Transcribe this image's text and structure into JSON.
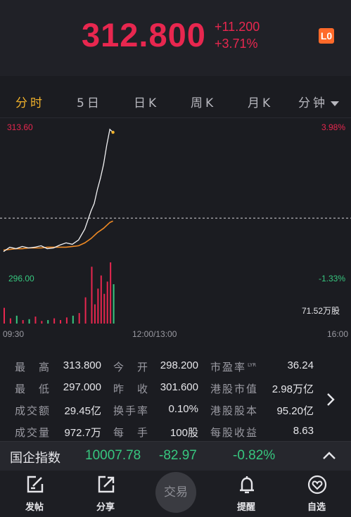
{
  "quote": {
    "price": "312.800",
    "change_abs": "+11.200",
    "change_pct": "+3.71%",
    "badge": "L0"
  },
  "tabs": [
    {
      "label": "分时",
      "active": true
    },
    {
      "label": "5日"
    },
    {
      "label": "日K"
    },
    {
      "label": "周K"
    },
    {
      "label": "月K"
    },
    {
      "label": "分钟"
    }
  ],
  "chart": {
    "price_high": "313.60",
    "pct_high": "3.98%",
    "price_low": "296.00",
    "pct_low": "-1.33%",
    "volume_label": "71.52万股",
    "time_start": "09:30",
    "time_mid": "12:00/13:00",
    "time_end": "16:00"
  },
  "chart_data": {
    "type": "line",
    "x": [
      0,
      2,
      4,
      6,
      8,
      10,
      12,
      14,
      16,
      18,
      20,
      22,
      24,
      26,
      28,
      29,
      30,
      31,
      32,
      33,
      34,
      35
    ],
    "price": [
      297.0,
      297.6,
      297.4,
      297.7,
      297.5,
      297.6,
      297.8,
      297.4,
      297.5,
      297.9,
      298.2,
      298.0,
      298.6,
      300.1,
      302.6,
      303.6,
      305.5,
      307.1,
      309.0,
      311.6,
      313.8,
      313.4
    ],
    "avg": [
      297.2,
      297.3,
      297.4,
      297.4,
      297.5,
      297.5,
      297.5,
      297.6,
      297.6,
      297.6,
      297.6,
      297.7,
      297.8,
      298.2,
      298.8,
      299.2,
      299.6,
      299.9,
      300.2,
      300.6,
      301.0,
      301.2
    ],
    "volume": [
      18,
      6,
      9,
      4,
      5,
      8,
      3,
      4,
      6,
      4,
      7,
      9,
      12,
      30,
      65,
      22,
      40,
      55,
      34,
      48,
      70,
      45
    ],
    "ylim": [
      296.0,
      313.6
    ],
    "prev_close": 301.6
  },
  "stats": {
    "high_label": "最　高",
    "high": "313.800",
    "open_label": "今　开",
    "open": "298.200",
    "pe_label": "市盈率",
    "pe_sup": "LYR",
    "pe": "36.24",
    "low_label": "最　低",
    "low": "297.000",
    "prev_label": "昨　收",
    "prev": "301.600",
    "mcap_label": "港股市值",
    "mcap": "2.98万亿",
    "turnover_label": "成交额",
    "turnover": "29.45亿",
    "rate_label": "换手率",
    "rate": "0.10%",
    "shares_label": "港股股本",
    "shares": "95.20亿",
    "vol_label": "成交量",
    "vol": "972.7万",
    "lot_label": "每　手",
    "lot": "100股",
    "eps_label": "每股收益",
    "eps": "8.63"
  },
  "index_bar": {
    "name": "国企指数",
    "value": "10007.78",
    "change": "-82.97",
    "pct": "-0.82%"
  },
  "bottom_nav": {
    "post": "发帖",
    "share": "分享",
    "trade": "交易",
    "alert": "提醒",
    "watchlist": "自选"
  },
  "colors": {
    "up": "#e8274f",
    "down": "#37c77f",
    "tab_active": "#f0b12b",
    "avg_line": "#f08a24"
  }
}
